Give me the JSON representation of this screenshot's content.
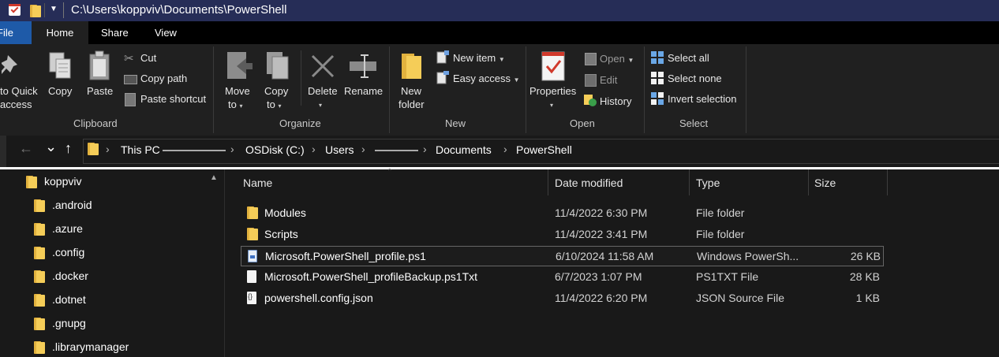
{
  "title_bar": {
    "path": "C:\\Users\\koppviv\\Documents\\PowerShell"
  },
  "menu": {
    "file": "File",
    "home": "Home",
    "share": "Share",
    "view": "View"
  },
  "ribbon": {
    "clipboard": {
      "pin_label_1": "to Quick",
      "pin_label_2": "access",
      "copy": "Copy",
      "paste": "Paste",
      "cut": "Cut",
      "copy_path": "Copy path",
      "paste_shortcut": "Paste shortcut",
      "group": "Clipboard"
    },
    "organize": {
      "move_to_1": "Move",
      "move_to_2": "to",
      "copy_to_1": "Copy",
      "copy_to_2": "to",
      "delete": "Delete",
      "rename": "Rename",
      "group": "Organize"
    },
    "new": {
      "new_folder_1": "New",
      "new_folder_2": "folder",
      "new_item": "New item",
      "easy_access": "Easy access",
      "group": "New"
    },
    "open": {
      "properties": "Properties",
      "open": "Open",
      "edit": "Edit",
      "history": "History",
      "group": "Open"
    },
    "select": {
      "select_all": "Select all",
      "select_none": "Select none",
      "invert": "Invert selection",
      "group": "Select"
    }
  },
  "nav": {
    "back": "←",
    "forward": "→",
    "recent": "⌄",
    "up": "↑"
  },
  "breadcrumb": [
    "This PC",
    "OSDisk (C:)",
    "Users",
    "Documents",
    "PowerShell"
  ],
  "nav_pane": {
    "items": [
      "koppviv",
      ".android",
      ".azure",
      ".config",
      ".docker",
      ".dotnet",
      ".gnupg",
      ".librarymanager"
    ]
  },
  "columns": {
    "name": "Name",
    "date": "Date modified",
    "type": "Type",
    "size": "Size"
  },
  "files": [
    {
      "name": "Modules",
      "date": "11/4/2022 6:30 PM",
      "type": "File folder",
      "size": "",
      "icon": "folder-icon"
    },
    {
      "name": "Scripts",
      "date": "11/4/2022 3:41 PM",
      "type": "File folder",
      "size": "",
      "icon": "folder-icon"
    },
    {
      "name": "Microsoft.PowerShell_profile.ps1",
      "date": "6/10/2024 11:58 AM",
      "type": "Windows PowerSh...",
      "size": "26 KB",
      "icon": "powershell-file-icon",
      "selected": true
    },
    {
      "name": "Microsoft.PowerShell_profileBackup.ps1Txt",
      "date": "6/7/2023 1:07 PM",
      "type": "PS1TXT File",
      "size": "28 KB",
      "icon": "file-icon"
    },
    {
      "name": "powershell.config.json",
      "date": "11/4/2022 6:20 PM",
      "type": "JSON Source File",
      "size": "1 KB",
      "icon": "json-file-icon"
    }
  ],
  "colors": {
    "title_bar": "#262d57",
    "file_tab": "#1e5aa8",
    "background": "#191919",
    "ribbon": "#202020",
    "folder": "#f5cd58"
  }
}
